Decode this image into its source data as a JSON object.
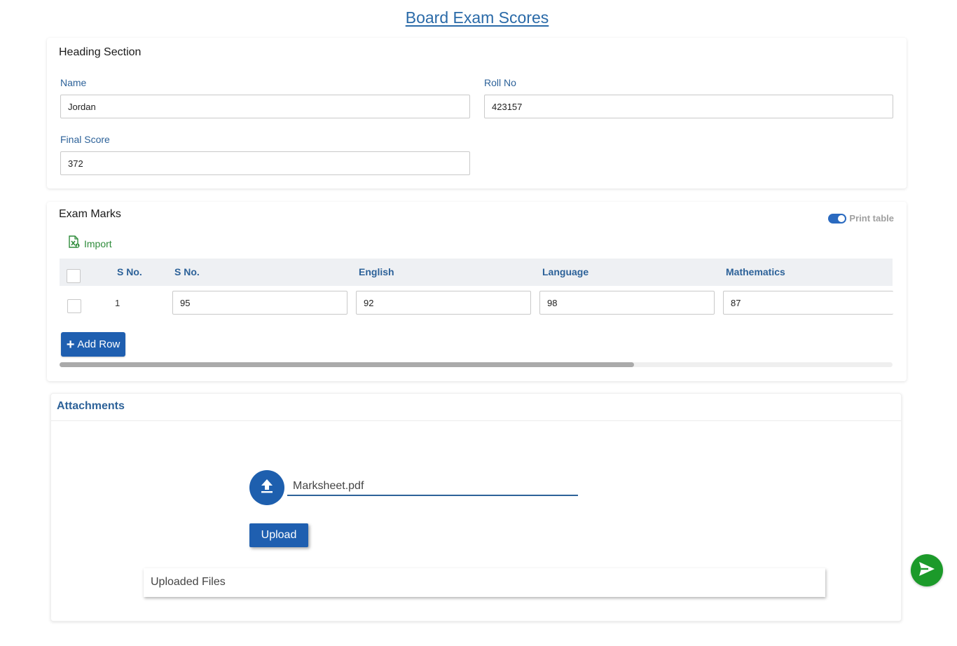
{
  "page": {
    "title": "Board Exam Scores"
  },
  "heading_section": {
    "title": "Heading Section",
    "name_label": "Name",
    "name_value": "Jordan",
    "roll_label": "Roll No",
    "roll_value": "423157",
    "final_score_label": "Final Score",
    "final_score_value": "372"
  },
  "exam_marks": {
    "title": "Exam Marks",
    "print_toggle_label": "Print table",
    "print_toggle_on": true,
    "import_label": "Import",
    "columns": [
      "S No.",
      "S No.",
      "English",
      "Language",
      "Mathematics"
    ],
    "rows": [
      {
        "no": "1",
        "values": [
          "95",
          "92",
          "98",
          "87"
        ]
      }
    ],
    "add_row_label": "Add Row",
    "horizontal_scroll_visible_fraction": 0.69
  },
  "attachments": {
    "title": "Attachments",
    "file_name": "Marksheet.pdf",
    "upload_label": "Upload",
    "uploaded_files_label": "Uploaded Files"
  },
  "colors": {
    "accent_blue": "#1f5fb0",
    "label_blue": "#2d6299",
    "import_green": "#2e8b3a",
    "send_green": "#1c9a2a"
  },
  "icons": {
    "import": "excel-import-icon",
    "add_row": "plus-icon",
    "upload": "upload-arrow-icon",
    "send": "send-icon"
  }
}
